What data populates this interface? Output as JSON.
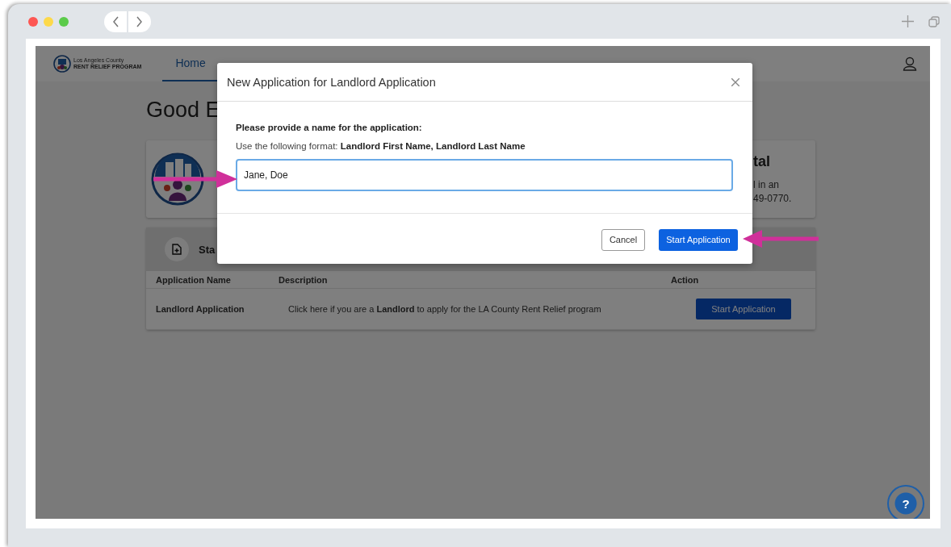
{
  "header": {
    "logo_line1": "Los Angeles County",
    "logo_line2": "RENT RELIEF PROGRAM",
    "nav": [
      {
        "label": "Home",
        "selected": true
      }
    ]
  },
  "page": {
    "heading": "Good E",
    "welcome_card": {
      "title": "tal",
      "lines": [
        "l in an",
        "49-0770."
      ]
    },
    "applications": {
      "title": "Sta",
      "columns": [
        "Application Name",
        "Description",
        "Action"
      ],
      "rows": [
        {
          "name": "Landlord Application",
          "description": "Click here if you are a **Landlord** to apply for the LA County Rent Relief program",
          "action": "Start Application"
        }
      ]
    }
  },
  "help_button": "?",
  "modal": {
    "title": "New Application for Landlord Application",
    "prompt": "Please provide a name for the application:",
    "format": "Use the following format: **Landlord First Name, Landlord Last Name**",
    "value": "Jane, Doe",
    "buttons": [
      {
        "label": "Cancel",
        "kind": "secondary"
      },
      {
        "label": "Start Application",
        "kind": "primary"
      }
    ]
  }
}
